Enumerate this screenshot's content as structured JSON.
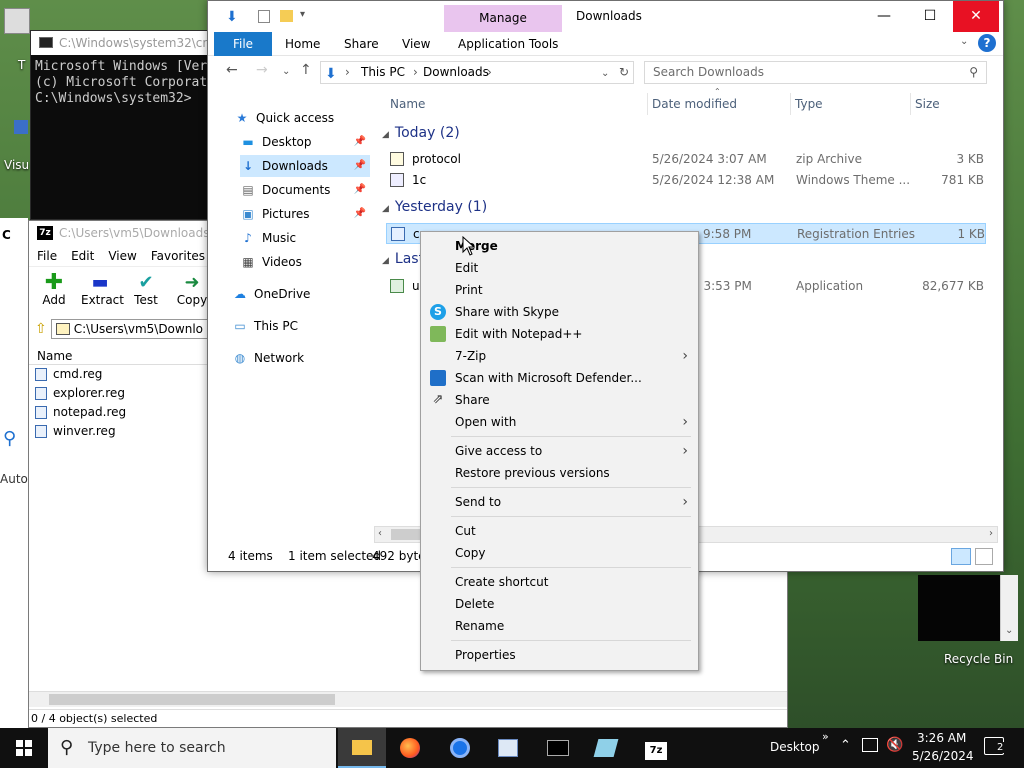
{
  "desktop": {
    "recycle_bin_label": "Recycle Bin",
    "visible_icon_label": "Visu",
    "cmd_icon_label": "C",
    "auto_label": "Auto",
    "t_label": "T"
  },
  "cmd": {
    "title": "C:\\Windows\\system32\\cmd.exe",
    "lines": [
      "Microsoft Windows [Ver",
      "(c) Microsoft Corporat",
      "",
      "C:\\Windows\\system32>"
    ]
  },
  "sevenzip": {
    "title": "C:\\Users\\vm5\\Downloads\\",
    "menu": [
      "File",
      "Edit",
      "View",
      "Favorites"
    ],
    "tools": [
      {
        "label": "Add",
        "icon": "+",
        "color": "#1a9a1a"
      },
      {
        "label": "Extract",
        "icon": "▬",
        "color": "#1a36c8"
      },
      {
        "label": "Test",
        "icon": "✔",
        "color": "#1aa0a0"
      },
      {
        "label": "Copy",
        "icon": "➜",
        "color": "#1a8a40"
      }
    ],
    "address": "C:\\Users\\vm5\\Downlo",
    "column_name": "Name",
    "files": [
      "cmd.reg",
      "explorer.reg",
      "notepad.reg",
      "winver.reg"
    ],
    "status": "0 / 4 object(s) selected"
  },
  "explorer": {
    "manage_label": "Manage",
    "title": "Downloads",
    "tabs": [
      "File",
      "Home",
      "Share",
      "View",
      "Application Tools"
    ],
    "address": [
      "This PC",
      "Downloads"
    ],
    "search_placeholder": "Search Downloads",
    "nav": [
      {
        "label": "Quick access",
        "icon": "★",
        "color": "#2a7ad8"
      },
      {
        "label": "Desktop",
        "icon": "▬",
        "color": "#1e90e0",
        "pinned": true
      },
      {
        "label": "Downloads",
        "icon": "↓",
        "color": "#1e70d0",
        "pinned": true,
        "selected": true
      },
      {
        "label": "Documents",
        "icon": "▤",
        "color": "#666",
        "pinned": true
      },
      {
        "label": "Pictures",
        "icon": "▣",
        "color": "#3a8ad0",
        "pinned": true
      },
      {
        "label": "Music",
        "icon": "♪",
        "color": "#1e70d0"
      },
      {
        "label": "Videos",
        "icon": "▦",
        "color": "#444"
      },
      {
        "label": "OneDrive",
        "icon": "☁",
        "color": "#1e80e0"
      },
      {
        "label": "This PC",
        "icon": "▭",
        "color": "#3a8ad0"
      },
      {
        "label": "Network",
        "icon": "◍",
        "color": "#3a8ad0"
      }
    ],
    "columns": [
      "Name",
      "Date modified",
      "Type",
      "Size"
    ],
    "groups": [
      {
        "label": "Today (2)"
      },
      {
        "label": "Yesterday (1)"
      },
      {
        "label": "Last"
      }
    ],
    "files": [
      {
        "name": "protocol",
        "date": "5/26/2024 3:07 AM",
        "type": "zip Archive",
        "size": "3 KB"
      },
      {
        "name": "1c",
        "date": "5/26/2024 12:38 AM",
        "type": "Windows Theme ...",
        "size": "781 KB"
      },
      {
        "name": "cr",
        "date": "9:58 PM",
        "type": "Registration Entries",
        "size": "1 KB"
      },
      {
        "name": "u",
        "date": "4 3:53 PM",
        "type": "Application",
        "size": "82,677 KB"
      }
    ],
    "status": {
      "items": "4 items",
      "selected": "1 item selected",
      "bytes": "492 bytes"
    }
  },
  "context_menu": {
    "items": [
      {
        "label": "Merge",
        "bold": true
      },
      {
        "label": "Edit"
      },
      {
        "label": "Print"
      },
      {
        "label": "Share with Skype",
        "icon": "skype-icon",
        "color": "#1ea0e8"
      },
      {
        "label": "Edit with Notepad++",
        "icon": "notepad-plus-plus-icon",
        "color": "#7fb85a"
      },
      {
        "label": "7-Zip",
        "submenu": true
      },
      {
        "label": "Scan with Microsoft Defender...",
        "icon": "defender-icon",
        "color": "#1f6fc8"
      },
      {
        "label": "Share",
        "icon": "share-icon"
      },
      {
        "label": "Open with",
        "submenu": true
      },
      {
        "label": "Give access to",
        "submenu": true
      },
      {
        "label": "Restore previous versions"
      },
      {
        "label": "Send to",
        "submenu": true
      },
      {
        "label": "Cut"
      },
      {
        "label": "Copy"
      },
      {
        "label": "Create shortcut"
      },
      {
        "label": "Delete"
      },
      {
        "label": "Rename"
      },
      {
        "label": "Properties"
      }
    ]
  },
  "taskbar": {
    "search_placeholder": "Type here to search",
    "desktop_label": "Desktop",
    "time": "3:26 AM",
    "date": "5/26/2024",
    "notifications": "2"
  }
}
